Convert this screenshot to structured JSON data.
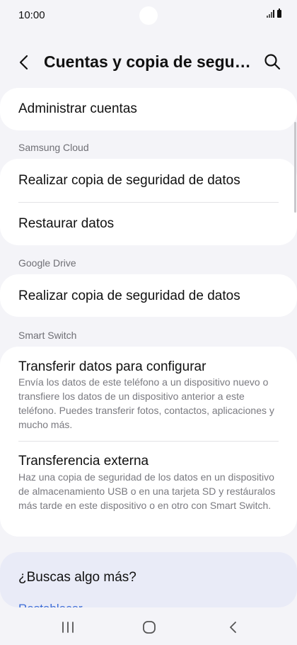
{
  "status_bar": {
    "time": "10:00"
  },
  "header": {
    "title": "Cuentas y copia de seguri..."
  },
  "manage_accounts": {
    "label": "Administrar cuentas"
  },
  "samsung_cloud": {
    "section_label": "Samsung Cloud",
    "backup_label": "Realizar copia de seguridad de datos",
    "restore_label": "Restaurar datos"
  },
  "google_drive": {
    "section_label": "Google Drive",
    "backup_label": "Realizar copia de seguridad de datos"
  },
  "smart_switch": {
    "section_label": "Smart Switch",
    "items": [
      {
        "title": "Transferir datos para configurar",
        "description": "Envía los datos de este teléfono a un dispositivo nuevo o transfiere los datos de un dispositivo anterior a este teléfono. Puedes transferir fotos, contactos, aplicaciones y mucho más."
      },
      {
        "title": "Transferencia externa",
        "description": "Haz una copia de seguridad de los datos en un dispositivo de almacenamiento USB o en una tarjeta SD y restáuralos más tarde en este dispositivo o en otro con Smart Switch."
      }
    ]
  },
  "looking_for_more": {
    "title": "¿Buscas algo más?",
    "link": "Restablecer"
  },
  "colors": {
    "accent": "#3b6bd6",
    "card": "#ffffff",
    "background": "#f4f4f8"
  }
}
